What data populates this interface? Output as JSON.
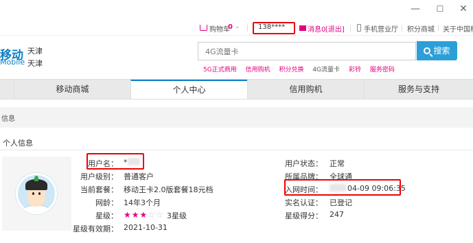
{
  "window": {
    "minimize_glyph": "—",
    "maximize_glyph": "☐",
    "close_glyph": "✕"
  },
  "topbar": {
    "cart_label": "购物车",
    "cart_count": "0",
    "cart_chevron": "⌄",
    "phone": "138****",
    "messages_label": "消息0",
    "logout_label": "[退出]",
    "hall_label": "手机营业厅",
    "points_mall_label": "积分商城",
    "about_label": "关于中国移动"
  },
  "header": {
    "logo_text": "移动",
    "logo_sub": "Mobile",
    "city_line1": "天津",
    "city_line2": "天津",
    "search_value": "4G流量卡",
    "search_button": "搜索",
    "hot_links": [
      {
        "label": "5G正式商用",
        "color": "pink"
      },
      {
        "label": "信用购机",
        "color": "pink"
      },
      {
        "label": "积分兑换",
        "color": "pink"
      },
      {
        "label": "4G流量卡",
        "color": "gray"
      },
      {
        "label": "彩铃",
        "color": "pink"
      },
      {
        "label": "服务密码",
        "color": "pink"
      }
    ]
  },
  "nav": {
    "tabs": [
      "移动商城",
      "个人中心",
      "信用购机",
      "服务与支持"
    ],
    "active_index": 1
  },
  "page": {
    "breadcrumb": "信息",
    "section_title": "个人信息"
  },
  "profile": {
    "username_label": "用户名：",
    "username_value": "*",
    "level_label": "用户级别：",
    "level_value": "普通客户",
    "plan_label": "当前套餐：",
    "plan_value": "移动王卡2.0版套餐18元档",
    "tenure_label": "网龄：",
    "tenure_value": "14年3个月",
    "star_label": "星级：",
    "star_rating": 3,
    "star_max": 5,
    "star_text": "3星级",
    "star_expiry_label": "星级有效期：",
    "star_expiry_value": "2021-10-31",
    "status_label": "用户状态：",
    "status_value": "正常",
    "brand_label": "所属品牌：",
    "brand_value": "全球通",
    "join_time_label": "入网时间：",
    "join_time_value": "04-09 09:06:35",
    "realname_label": "实名认证：",
    "realname_value": "已登记",
    "star_score_label": "星级得分：",
    "star_score_value": "247"
  },
  "colors": {
    "brand_blue": "#0b7fc5",
    "accent_pink": "#e4007f",
    "highlight_red": "#e00000",
    "search_button": "#2d9fd8"
  }
}
